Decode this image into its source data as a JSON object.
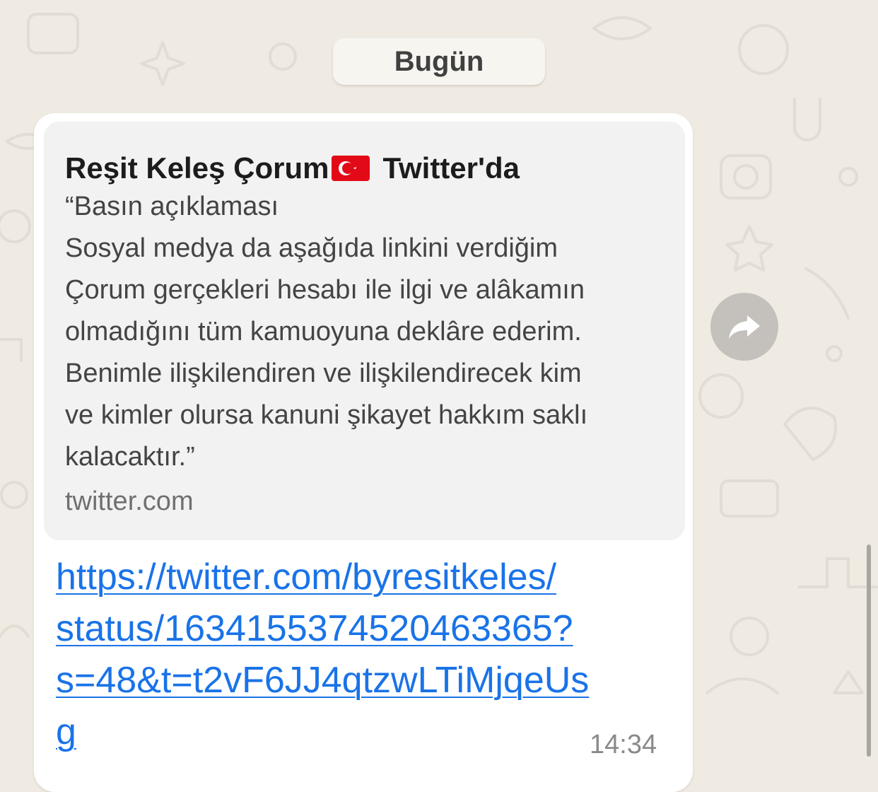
{
  "date_divider": {
    "label": "Bugün"
  },
  "message": {
    "preview": {
      "title": "Reşit Keleş Çorum",
      "title_suffix": "Twitter'da",
      "flag_icon": "turkey-flag",
      "description": "“Basın açıklaması\nSosyal medya da aşağıda linkini verdiğim\nÇorum gerçekleri hesabı ile ilgi ve alâkamın\nolmadığını tüm kamuoyuna deklâre ederim.\nBenimle ilişkilendiren ve ilişkilendirecek kim\nve kimler olursa kanuni şikayet hakkım saklı\nkalacaktır.”",
      "domain": "twitter.com"
    },
    "link_text": "https://twitter.com/byresitkeles/\nstatus/1634155374520463365?\ns=48&t=t2vF6JJ4qtzwLTiMjqeUs\ng",
    "time": "14:34"
  },
  "forward_icon": "forward-arrow-icon",
  "colors": {
    "background": "#efeae2",
    "bubble": "#ffffff",
    "link": "#1a73e8",
    "forward_button": "#c4c1bc"
  }
}
